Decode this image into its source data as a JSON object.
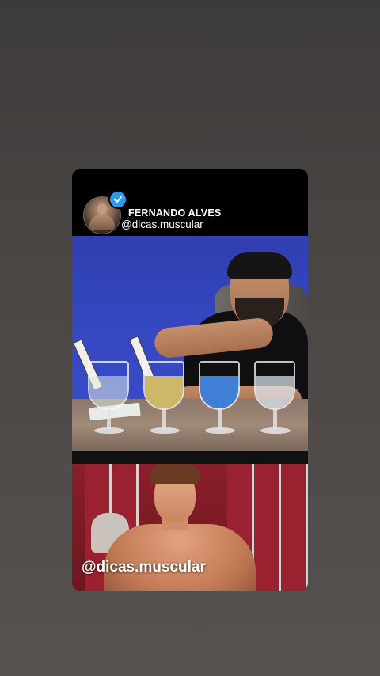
{
  "post": {
    "author_name": "FERNANDO ALVES",
    "author_handle": "@dicas.muscular",
    "verified": true,
    "verified_color": "#2d9bf0"
  },
  "video": {
    "watermark": "@dicas.muscular"
  }
}
